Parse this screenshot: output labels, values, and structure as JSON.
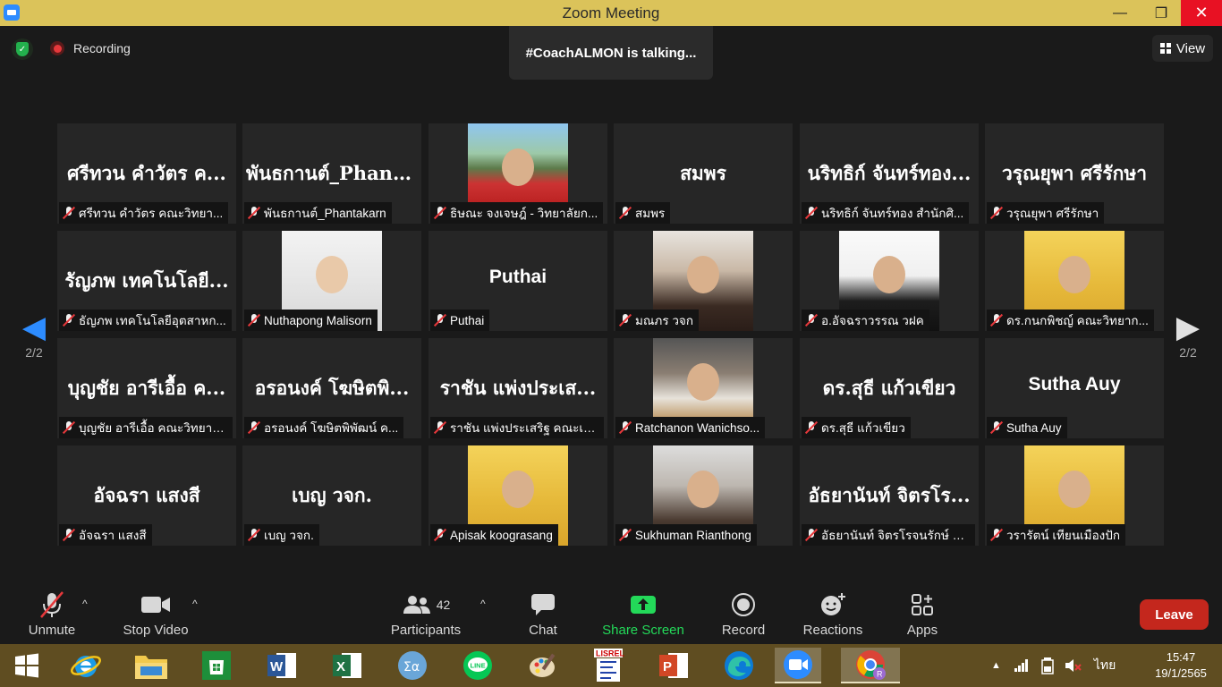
{
  "window": {
    "title": "Zoom Meeting",
    "minimize_glyph": "—",
    "maximize_glyph": "❐",
    "close_glyph": "✕"
  },
  "topbar": {
    "recording_label": "Recording",
    "talking_text": "#CoachALMON is talking...",
    "view_label": "View"
  },
  "pager": {
    "left_arrow": "◀",
    "right_arrow": "▶",
    "left_page": "2/2",
    "right_page": "2/2"
  },
  "participants": [
    {
      "big": "ศรีทวน  คำวัตร ค...",
      "label": "ศรีทวน  คำวัตร คณะวิทยา...",
      "photo": ""
    },
    {
      "big": "พันธกานต์_Phant...",
      "label": "พันธกานต์_Phantakarn",
      "photo": ""
    },
    {
      "big": "",
      "label": "ธิษณะ จงเจษฎ์ - วิทยาลัยก...",
      "photo": "outdoor"
    },
    {
      "big": "สมพร",
      "label": "สมพร",
      "photo": ""
    },
    {
      "big": "นริทธิก์ จันทร์ทอง...",
      "label": "นริทธิก์ จันทร์ทอง สำนักศิ...",
      "photo": ""
    },
    {
      "big": "วรุณยุพา ศรีรักษา",
      "label": "วรุณยุพา ศรีรักษา",
      "photo": ""
    },
    {
      "big": "รัญภพ เทคโนโลยี...",
      "label": "ธัญภพ เทคโนโลยีอุตสาหก...",
      "photo": ""
    },
    {
      "big": "",
      "label": "Nuthapong Malisorn",
      "photo": "white"
    },
    {
      "big": "Puthai",
      "label": "Puthai",
      "photo": "",
      "latin": true
    },
    {
      "big": "",
      "label": "มณภร วจก",
      "photo": "woman"
    },
    {
      "big": "",
      "label": "อ.อัจฉราวรรณ วฝค",
      "photo": "suit"
    },
    {
      "big": "",
      "label": "ดร.กนกพิชญ์ คณะวิทยาก...",
      "photo": "yellow"
    },
    {
      "big": "บุญชัย อารีเอื้อ ค...",
      "label": "บุญชัย อารีเอื้อ คณะวิทยาศ...",
      "photo": ""
    },
    {
      "big": "อรอนงค์ โฆษิตพิ...",
      "label": "อรอนงค์ โฆษิตพิพัฒน์ ค...",
      "photo": ""
    },
    {
      "big": "ราชัน แพ่งประเส...",
      "label": "ราชัน แพ่งประเสริฐ คณะเท...",
      "photo": ""
    },
    {
      "big": "",
      "label": "Ratchanon Wanichso...",
      "photo": "cafe"
    },
    {
      "big": "ดร.สุธี  แก้วเขียว",
      "label": "ดร.สุธี  แก้วเขียว",
      "photo": ""
    },
    {
      "big": "Sutha Auy",
      "label": "Sutha Auy",
      "photo": "",
      "latin": true
    },
    {
      "big": "อัจฉรา แสงสี",
      "label": "อัจฉรา แสงสี",
      "photo": ""
    },
    {
      "big": "เบญ วจก.",
      "label": "เบญ วจก.",
      "photo": ""
    },
    {
      "big": "",
      "label": "Apisak koograsang",
      "photo": "yellow"
    },
    {
      "big": "",
      "label": "Sukhuman Rianthong",
      "photo": "room"
    },
    {
      "big": "อัธยานันท์ จิตรโร...",
      "label": "อัธยานันท์ จิตรโรจนรักษ์ ค...",
      "photo": ""
    },
    {
      "big": "",
      "label": "วรารัตน์ เทียนเมืองปัก",
      "photo": "yellow"
    }
  ],
  "controls": {
    "unmute": "Unmute",
    "stop_video": "Stop Video",
    "participants": "Participants",
    "participants_count": "42",
    "chat": "Chat",
    "share_screen": "Share Screen",
    "record": "Record",
    "reactions": "Reactions",
    "apps": "Apps",
    "leave": "Leave",
    "caret": "^"
  },
  "taskbar": {
    "language": "ไทย",
    "time": "15:47",
    "date": "19/1/2565"
  },
  "colors": {
    "titlebar": "#dbc35a",
    "accent_blue": "#2d8cff",
    "share_green": "#23d959",
    "leave_red": "#c4271d",
    "taskbar": "#5f4d21"
  }
}
